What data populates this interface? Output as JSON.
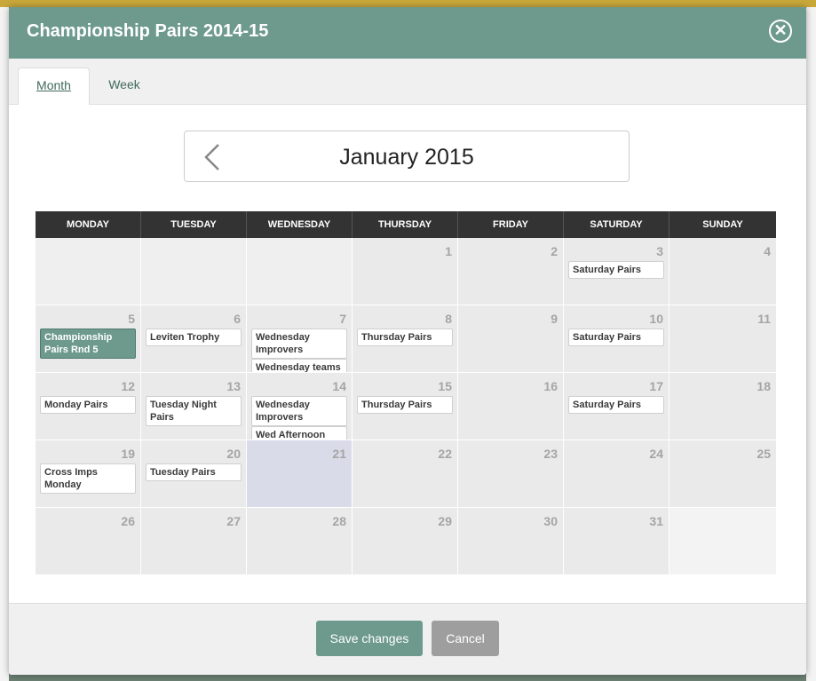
{
  "modal": {
    "title": "Championship Pairs 2014-15",
    "close_icon": "close-icon"
  },
  "tabs": [
    {
      "label": "Month",
      "active": true
    },
    {
      "label": "Week",
      "active": false
    }
  ],
  "calendar": {
    "month_label": "January 2015",
    "prev_icon": "chevron-left-icon",
    "weekdays": [
      "MONDAY",
      "TUESDAY",
      "WEDNESDAY",
      "THURSDAY",
      "FRIDAY",
      "SATURDAY",
      "SUNDAY"
    ],
    "weeks": [
      [
        {
          "num": "",
          "kind": "empty",
          "events": []
        },
        {
          "num": "",
          "kind": "empty",
          "events": []
        },
        {
          "num": "",
          "kind": "empty",
          "events": []
        },
        {
          "num": "1",
          "events": []
        },
        {
          "num": "2",
          "events": []
        },
        {
          "num": "3",
          "events": [
            "Saturday Pairs"
          ]
        },
        {
          "num": "4",
          "events": []
        }
      ],
      [
        {
          "num": "5",
          "events": [
            "Championship Pairs Rnd 5"
          ],
          "highlight_first": true
        },
        {
          "num": "6",
          "events": [
            "Leviten Trophy"
          ]
        },
        {
          "num": "7",
          "events": [
            "Wednesday Improvers",
            "Wednesday teams"
          ]
        },
        {
          "num": "8",
          "events": [
            "Thursday Pairs"
          ]
        },
        {
          "num": "9",
          "events": []
        },
        {
          "num": "10",
          "events": [
            "Saturday Pairs"
          ]
        },
        {
          "num": "11",
          "events": []
        }
      ],
      [
        {
          "num": "12",
          "events": [
            "Monday Pairs"
          ]
        },
        {
          "num": "13",
          "events": [
            "Tuesday Night Pairs"
          ]
        },
        {
          "num": "14",
          "events": [
            "Wednesday Improvers",
            "Wed Afternoon"
          ]
        },
        {
          "num": "15",
          "events": [
            "Thursday Pairs"
          ]
        },
        {
          "num": "16",
          "events": []
        },
        {
          "num": "17",
          "events": [
            "Saturday Pairs"
          ]
        },
        {
          "num": "18",
          "events": []
        }
      ],
      [
        {
          "num": "19",
          "events": [
            "Cross Imps Monday"
          ]
        },
        {
          "num": "20",
          "events": [
            "Tuesday Pairs"
          ]
        },
        {
          "num": "21",
          "kind": "today",
          "events": []
        },
        {
          "num": "22",
          "events": []
        },
        {
          "num": "23",
          "events": []
        },
        {
          "num": "24",
          "events": []
        },
        {
          "num": "25",
          "events": []
        }
      ],
      [
        {
          "num": "26",
          "events": []
        },
        {
          "num": "27",
          "events": []
        },
        {
          "num": "28",
          "events": []
        },
        {
          "num": "29",
          "events": []
        },
        {
          "num": "30",
          "events": []
        },
        {
          "num": "31",
          "events": []
        },
        {
          "num": "",
          "kind": "pad",
          "events": []
        }
      ]
    ]
  },
  "footer": {
    "save_label": "Save changes",
    "cancel_label": "Cancel"
  },
  "colors": {
    "header_bg": "#6e9a8d",
    "highlight_event": "#6e9a8d",
    "today_cell": "#d9dbe8"
  }
}
